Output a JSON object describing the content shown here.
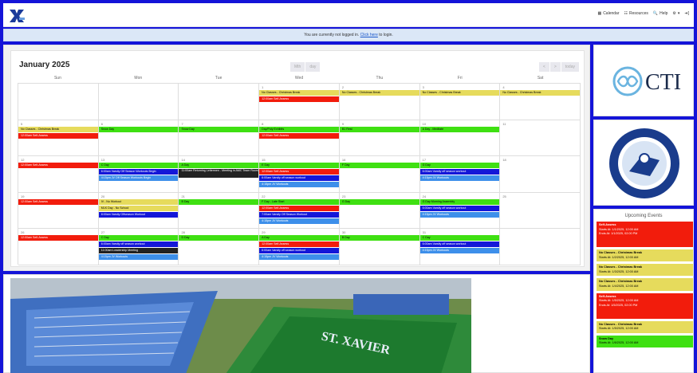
{
  "header": {
    "nav": [
      {
        "label": "Calendar",
        "icon": "calendar-icon"
      },
      {
        "label": "Resources",
        "icon": "resources-icon"
      },
      {
        "label": "Help",
        "icon": "help-icon"
      }
    ]
  },
  "notice": {
    "before": "You are currently not logged in. ",
    "link": "Click here",
    "after": " to login."
  },
  "calendar": {
    "title": "January 2025",
    "views": [
      "Mth",
      "day"
    ],
    "nav": [
      "<",
      ">",
      "today"
    ],
    "day_headers": [
      "Sun",
      "Mon",
      "Tue",
      "Wed",
      "Thu",
      "Fri",
      "Sat"
    ],
    "weeks": [
      [
        {
          "day": "",
          "events": []
        },
        {
          "day": "",
          "events": []
        },
        {
          "day": "",
          "events": []
        },
        {
          "day": "1",
          "events": [
            {
              "label": "No Classes - Christmas Break",
              "color": "yellow"
            },
            {
              "label": "12:00am Self-Assess",
              "color": "red"
            }
          ]
        },
        {
          "day": "2",
          "events": [
            {
              "label": "No Classes - Christmas Break",
              "color": "yellow"
            }
          ]
        },
        {
          "day": "3",
          "events": [
            {
              "label": "No Classes - Christmas Break",
              "color": "yellow"
            }
          ]
        },
        {
          "day": "4",
          "events": [
            {
              "label": "No Classes - Christmas Break",
              "color": "yellow"
            }
          ]
        }
      ],
      [
        {
          "day": "5",
          "events": [
            {
              "label": "No Classes - Christmas Break",
              "color": "yellow"
            },
            {
              "label": "12:00am Self-Assess",
              "color": "red"
            }
          ]
        },
        {
          "day": "6",
          "events": [
            {
              "label": "Snow Day",
              "color": "green"
            }
          ]
        },
        {
          "day": "7",
          "events": [
            {
              "label": "Snow Day",
              "color": "green"
            }
          ]
        },
        {
          "day": "8",
          "events": [
            {
              "label": "Day/Poly Exhibits",
              "color": "green"
            },
            {
              "label": "12:00am Self-Assess",
              "color": "red"
            }
          ]
        },
        {
          "day": "9",
          "events": [
            {
              "label": "B1 Rest",
              "color": "green"
            }
          ]
        },
        {
          "day": "10",
          "events": [
            {
              "label": "A Day - Meditate",
              "color": "green"
            }
          ]
        },
        {
          "day": "11",
          "events": []
        }
      ],
      [
        {
          "day": "12",
          "events": [
            {
              "label": "12:00am Self-Assess",
              "color": "red"
            }
          ]
        },
        {
          "day": "13",
          "events": [
            {
              "label": "C Day",
              "color": "green"
            },
            {
              "label": "6:00am Varsity Off Season Workouts Begin",
              "color": "blue"
            },
            {
              "label": "4:15pm JV Off Season Workouts Begin",
              "color": "lblue"
            }
          ]
        },
        {
          "day": "14",
          "events": [
            {
              "label": "A Day",
              "color": "green"
            },
            {
              "label": "11:00am Returning Lettermen - Meeting in AMC Team Room",
              "color": "black",
              "tall": true
            }
          ]
        },
        {
          "day": "15",
          "events": [
            {
              "label": "E Day",
              "color": "green"
            },
            {
              "label": "12:00am Self-Assess",
              "color": "red"
            },
            {
              "label": "6:00am Varsity off season workout",
              "color": "blue"
            },
            {
              "label": "4:15pm JV Workouts",
              "color": "lblue"
            }
          ]
        },
        {
          "day": "16",
          "events": [
            {
              "label": "F Day",
              "color": "green"
            }
          ]
        },
        {
          "day": "17",
          "events": [
            {
              "label": "G Day",
              "color": "green"
            },
            {
              "label": "6:00am Varsity off season workout",
              "color": "blue"
            },
            {
              "label": "4:15pm JV Workouts",
              "color": "lblue"
            }
          ]
        },
        {
          "day": "18",
          "events": []
        }
      ],
      [
        {
          "day": "19",
          "events": [
            {
              "label": "12:00am Self-Assess",
              "color": "red"
            }
          ]
        },
        {
          "day": "20",
          "events": [
            {
              "label": "IV - No Workout",
              "color": "yellow"
            },
            {
              "label": "MLK Day - No School",
              "color": "yellow"
            },
            {
              "label": "8:00am Varsity Offseason Workout",
              "color": "blue"
            }
          ]
        },
        {
          "day": "21",
          "events": [
            {
              "label": "B Day",
              "color": "green"
            }
          ]
        },
        {
          "day": "22",
          "events": [
            {
              "label": "F Day - Late Start",
              "color": "green"
            },
            {
              "label": "12:00am Self-Assess",
              "color": "red"
            },
            {
              "label": "7:00am Varsity Off Season Workout",
              "color": "blue"
            },
            {
              "label": "4:15pm JV Workouts",
              "color": "lblue"
            }
          ]
        },
        {
          "day": "23",
          "events": [
            {
              "label": "G Day",
              "color": "green"
            }
          ]
        },
        {
          "day": "24",
          "events": [
            {
              "label": "G Day Morning Assembly",
              "color": "green"
            },
            {
              "label": "6:00am Varsity off season workout",
              "color": "blue"
            },
            {
              "label": "4:15pm JV Workouts",
              "color": "lblue"
            }
          ]
        },
        {
          "day": "25",
          "events": []
        }
      ],
      [
        {
          "day": "26",
          "events": [
            {
              "label": "12:00am Self-Assess",
              "color": "red"
            }
          ]
        },
        {
          "day": "27",
          "events": [
            {
              "label": "C Day",
              "color": "green"
            },
            {
              "label": "6:00am Varsity off season workout",
              "color": "blue"
            },
            {
              "label": "11:00am Leadership Meeting",
              "color": "black"
            },
            {
              "label": "4:15pm JV Workouts",
              "color": "lblue"
            }
          ]
        },
        {
          "day": "28",
          "events": [
            {
              "label": "D Day",
              "color": "green"
            }
          ]
        },
        {
          "day": "29",
          "events": [
            {
              "label": "A Day",
              "color": "green"
            },
            {
              "label": "12:00am Self-Assess",
              "color": "red"
            },
            {
              "label": "6:00am Varsity off season workout",
              "color": "blue"
            },
            {
              "label": "4:15pm JV Workouts",
              "color": "lblue"
            }
          ]
        },
        {
          "day": "30",
          "events": [
            {
              "label": "B Day",
              "color": "green"
            }
          ]
        },
        {
          "day": "31",
          "events": [
            {
              "label": "C Day",
              "color": "green"
            },
            {
              "label": "6:00am Varsity off season workout",
              "color": "blue"
            },
            {
              "label": "4:15pm JV Workouts",
              "color": "lblue"
            }
          ]
        },
        {
          "day": "",
          "events": []
        }
      ]
    ]
  },
  "sidebar": {
    "cti_text": "CTI",
    "upcoming_title": "Upcoming Events",
    "events": [
      {
        "title": "Self-Assess",
        "lines": [
          "Starts At: 1/1/2025, 12:00 AM",
          "Ends At: 1/1/2025, 02:00 PM"
        ],
        "color": "red",
        "tall": true
      },
      {
        "title": "No Classes - Christmas Break",
        "lines": [
          "Starts At: 1/2/2025, 12:00 AM"
        ],
        "color": "yellow"
      },
      {
        "title": "No Classes - Christmas Break",
        "lines": [
          "Starts At: 1/3/2025, 12:00 AM"
        ],
        "color": "yellow"
      },
      {
        "title": "No Classes - Christmas Break",
        "lines": [
          "Starts At: 1/4/2025, 12:00 AM"
        ],
        "color": "yellow"
      },
      {
        "title": "Self-Assess",
        "lines": [
          "Starts At: 1/5/2025, 12:00 AM",
          "Ends At: 1/5/2025, 02:00 PM"
        ],
        "color": "red",
        "tall": true
      },
      {
        "title": "No Classes - Christmas Break",
        "lines": [
          "Starts At: 1/5/2025, 12:00 AM"
        ],
        "color": "yellow"
      },
      {
        "title": "Snow Day",
        "lines": [
          "Starts At: 1/6/2025, 12:00 AM"
        ],
        "color": "green"
      }
    ]
  },
  "stadium": {
    "sign": "ST. XAVIER"
  }
}
